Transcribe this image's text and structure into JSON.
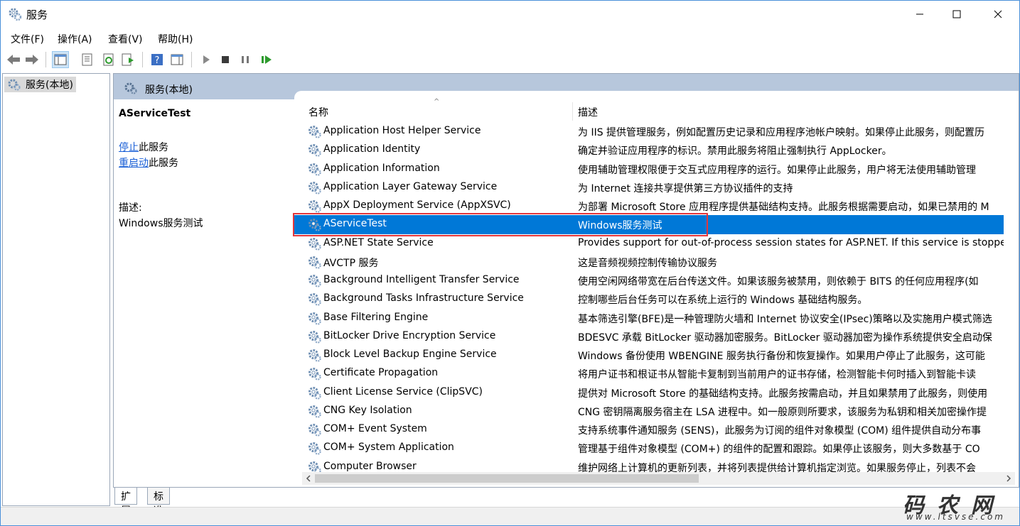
{
  "window": {
    "title": "服务"
  },
  "menu": [
    "文件(F)",
    "操作(A)",
    "查看(V)",
    "帮助(H)"
  ],
  "tree": {
    "root": "服务(本地)"
  },
  "panel": {
    "header": "服务(本地)",
    "selected_name": "AServiceTest",
    "stop_link": "停止",
    "stop_suffix": "此服务",
    "restart_link": "重启动",
    "restart_suffix": "此服务",
    "desc_label": "描述:",
    "desc_value": "Windows服务测试"
  },
  "columns": {
    "name": "名称",
    "desc": "描述"
  },
  "services": [
    {
      "name": "Application Host Helper Service",
      "desc": "为 IIS 提供管理服务，例如配置历史记录和应用程序池帐户映射。如果停止此服务，则配置历"
    },
    {
      "name": "Application Identity",
      "desc": "确定并验证应用程序的标识。禁用此服务将阻止强制执行 AppLocker。"
    },
    {
      "name": "Application Information",
      "desc": "使用辅助管理权限便于交互式应用程序的运行。如果停止此服务，用户将无法使用辅助管理"
    },
    {
      "name": "Application Layer Gateway Service",
      "desc": "为 Internet 连接共享提供第三方协议插件的支持"
    },
    {
      "name": "AppX Deployment Service (AppXSVC)",
      "desc": "为部署 Microsoft Store 应用程序提供基础结构支持。此服务根据需要启动，如果已禁用的 M"
    },
    {
      "name": "AServiceTest",
      "desc": "Windows服务测试",
      "selected": true
    },
    {
      "name": "ASP.NET State Service",
      "desc": "Provides support for out-of-process session states for ASP.NET. If this service is stopped, o"
    },
    {
      "name": "AVCTP 服务",
      "desc": "这是音频视频控制传输协议服务"
    },
    {
      "name": "Background Intelligent Transfer Service",
      "desc": "使用空闲网络带宽在后台传送文件。如果该服务被禁用，则依赖于 BITS 的任何应用程序(如"
    },
    {
      "name": "Background Tasks Infrastructure Service",
      "desc": "控制哪些后台任务可以在系统上运行的 Windows 基础结构服务。"
    },
    {
      "name": "Base Filtering Engine",
      "desc": "基本筛选引擎(BFE)是一种管理防火墙和 Internet 协议安全(IPsec)策略以及实施用户模式筛选"
    },
    {
      "name": "BitLocker Drive Encryption Service",
      "desc": "BDESVC 承载 BitLocker 驱动器加密服务。BitLocker 驱动器加密为操作系统提供安全启动保"
    },
    {
      "name": "Block Level Backup Engine Service",
      "desc": "Windows 备份使用 WBENGINE 服务执行备份和恢复操作。如果用户停止了此服务，这可能"
    },
    {
      "name": "Certificate Propagation",
      "desc": "将用户证书和根证书从智能卡复制到当前用户的证书存储，检测智能卡何时插入到智能卡读"
    },
    {
      "name": "Client License Service (ClipSVC)",
      "desc": "提供对 Microsoft Store 的基础结构支持。此服务按需启动，并且如果禁用了此服务，则使用"
    },
    {
      "name": "CNG Key Isolation",
      "desc": "CNG 密钥隔离服务宿主在 LSA 进程中。如一般原则所要求，该服务为私钥和相关加密操作提"
    },
    {
      "name": "COM+ Event System",
      "desc": "支持系统事件通知服务 (SENS)，此服务为订阅的组件对象模型 (COM) 组件提供自动分布事"
    },
    {
      "name": "COM+ System Application",
      "desc": "管理基于组件对象模型 (COM+) 的组件的配置和跟踪。如果停止该服务，则大多数基于 CO"
    },
    {
      "name": "Computer Browser",
      "desc": "维护网络上计算机的更新列表，并将列表提供给计算机指定浏览。如果服务停止，列表不会"
    }
  ],
  "tabs": [
    "扩展",
    "标准"
  ],
  "watermark": {
    "big": "码农网",
    "small": "www.ltsvse.com"
  }
}
